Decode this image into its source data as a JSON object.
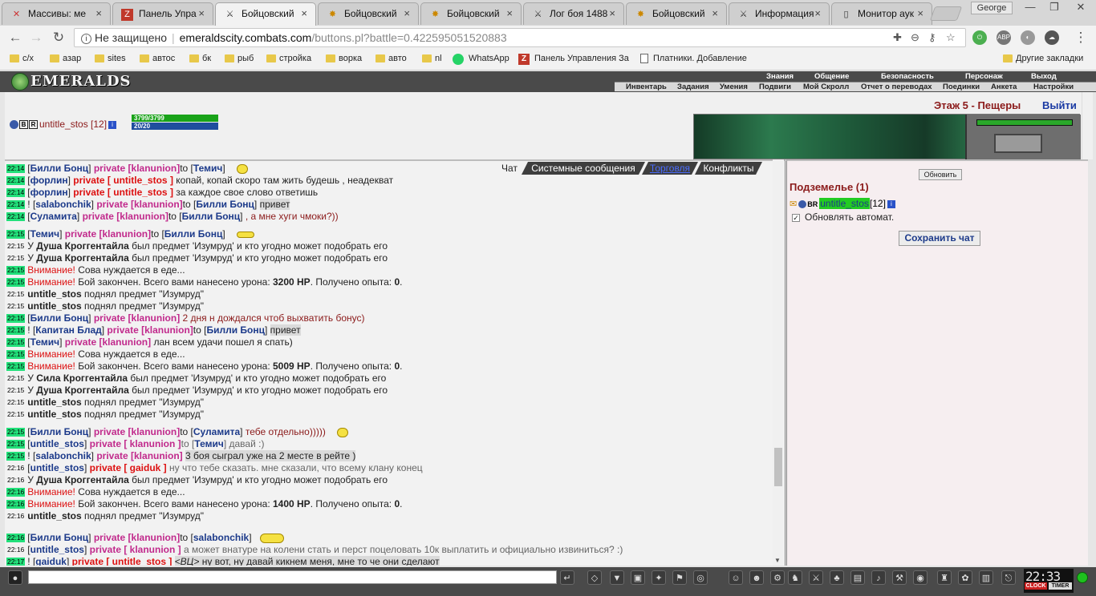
{
  "browser": {
    "tabs": [
      {
        "title": "Массивы: ме",
        "icon": "tab-icon-x"
      },
      {
        "title": "Панель Упра",
        "icon": "tab-icon-z"
      },
      {
        "title": "Бойцовский",
        "icon": "tab-icon-swords",
        "active": true
      },
      {
        "title": "Бойцовский",
        "icon": "tab-icon-star"
      },
      {
        "title": "Бойцовский",
        "icon": "tab-icon-star"
      },
      {
        "title": "Лог боя 1488",
        "icon": "tab-icon-swords"
      },
      {
        "title": "Бойцовский",
        "icon": "tab-icon-star"
      },
      {
        "title": "Информация",
        "icon": "tab-icon-swords"
      },
      {
        "title": "Монитор аук",
        "icon": "tab-icon-page"
      }
    ],
    "user": "George",
    "security": "Не защищено",
    "host": "emeraldscity.combats.com",
    "path": "/buttons.pl?battle=0.422595051520883",
    "bookmarks": [
      "с/х",
      "азар",
      "sites",
      "автос",
      "бк",
      "рыб",
      "стройка",
      "ворка",
      "авто",
      "nl",
      "WhatsApp",
      "Панель Управления За",
      "Платники. Добавление"
    ],
    "other_bookmarks": "Другие закладки"
  },
  "game": {
    "logo": "EMERALDS",
    "menu_top": [
      "Знания",
      "Общение",
      "Безопасность",
      "Персонаж",
      "Выход"
    ],
    "menu_sub": [
      "Инвентарь",
      "Задания",
      "Умения",
      "Подвиги",
      "Мой Скролл",
      "Отчет о переводах",
      "Поединки",
      "Анкета",
      "Настройки"
    ],
    "location": "Этаж 5 - Пещеры",
    "exit": "Выйти",
    "player": {
      "name": "untitle_stos",
      "level": "[12]",
      "hp": "3799/3799",
      "mp": "20/20"
    },
    "chat_tabs": [
      "Чат",
      "Системные сообщения",
      "Торговля",
      "Конфликты"
    ],
    "side": {
      "refresh": "Обновить",
      "room": "Подземелье (1)",
      "occupant": "untitle_stos",
      "occupant_level": "[12]",
      "auto_refresh": "Обновлять автомат.",
      "save_chat": "Сохранить чат"
    },
    "clock": {
      "time": "22:33",
      "clock_label": "CLOCK",
      "timer_label": "TIMER"
    }
  }
}
